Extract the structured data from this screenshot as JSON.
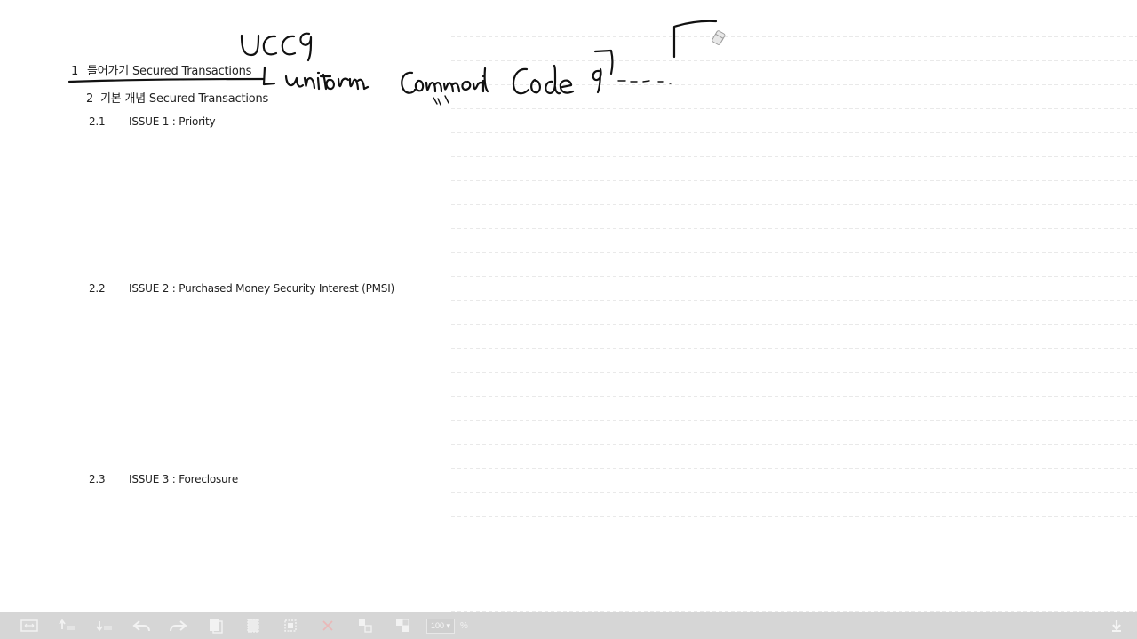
{
  "outline": {
    "h1": {
      "number": "1",
      "text": "들어가기 Secured Transactions"
    },
    "h2": {
      "number": "2",
      "text": "기본 개념 Secured Transactions"
    },
    "issues": [
      {
        "number": "2.1",
        "text": "ISSUE 1 : Priority"
      },
      {
        "number": "2.2",
        "text": "ISSUE 2 : Purchased Money Security Interest (PMSI)"
      },
      {
        "number": "2.3",
        "text": "ISSUE 3 : Foreclosure"
      }
    ]
  },
  "toolbar": {
    "zoom_value": "100",
    "zoom_unit": "%",
    "icons": [
      "fit-width-icon",
      "move-up-icon",
      "move-down-icon",
      "undo-icon",
      "redo-icon",
      "copy-page-icon",
      "blank-page-icon",
      "select-icon",
      "delete-icon",
      "grid-icon",
      "layout-icon",
      "scroll-down-icon"
    ]
  }
}
